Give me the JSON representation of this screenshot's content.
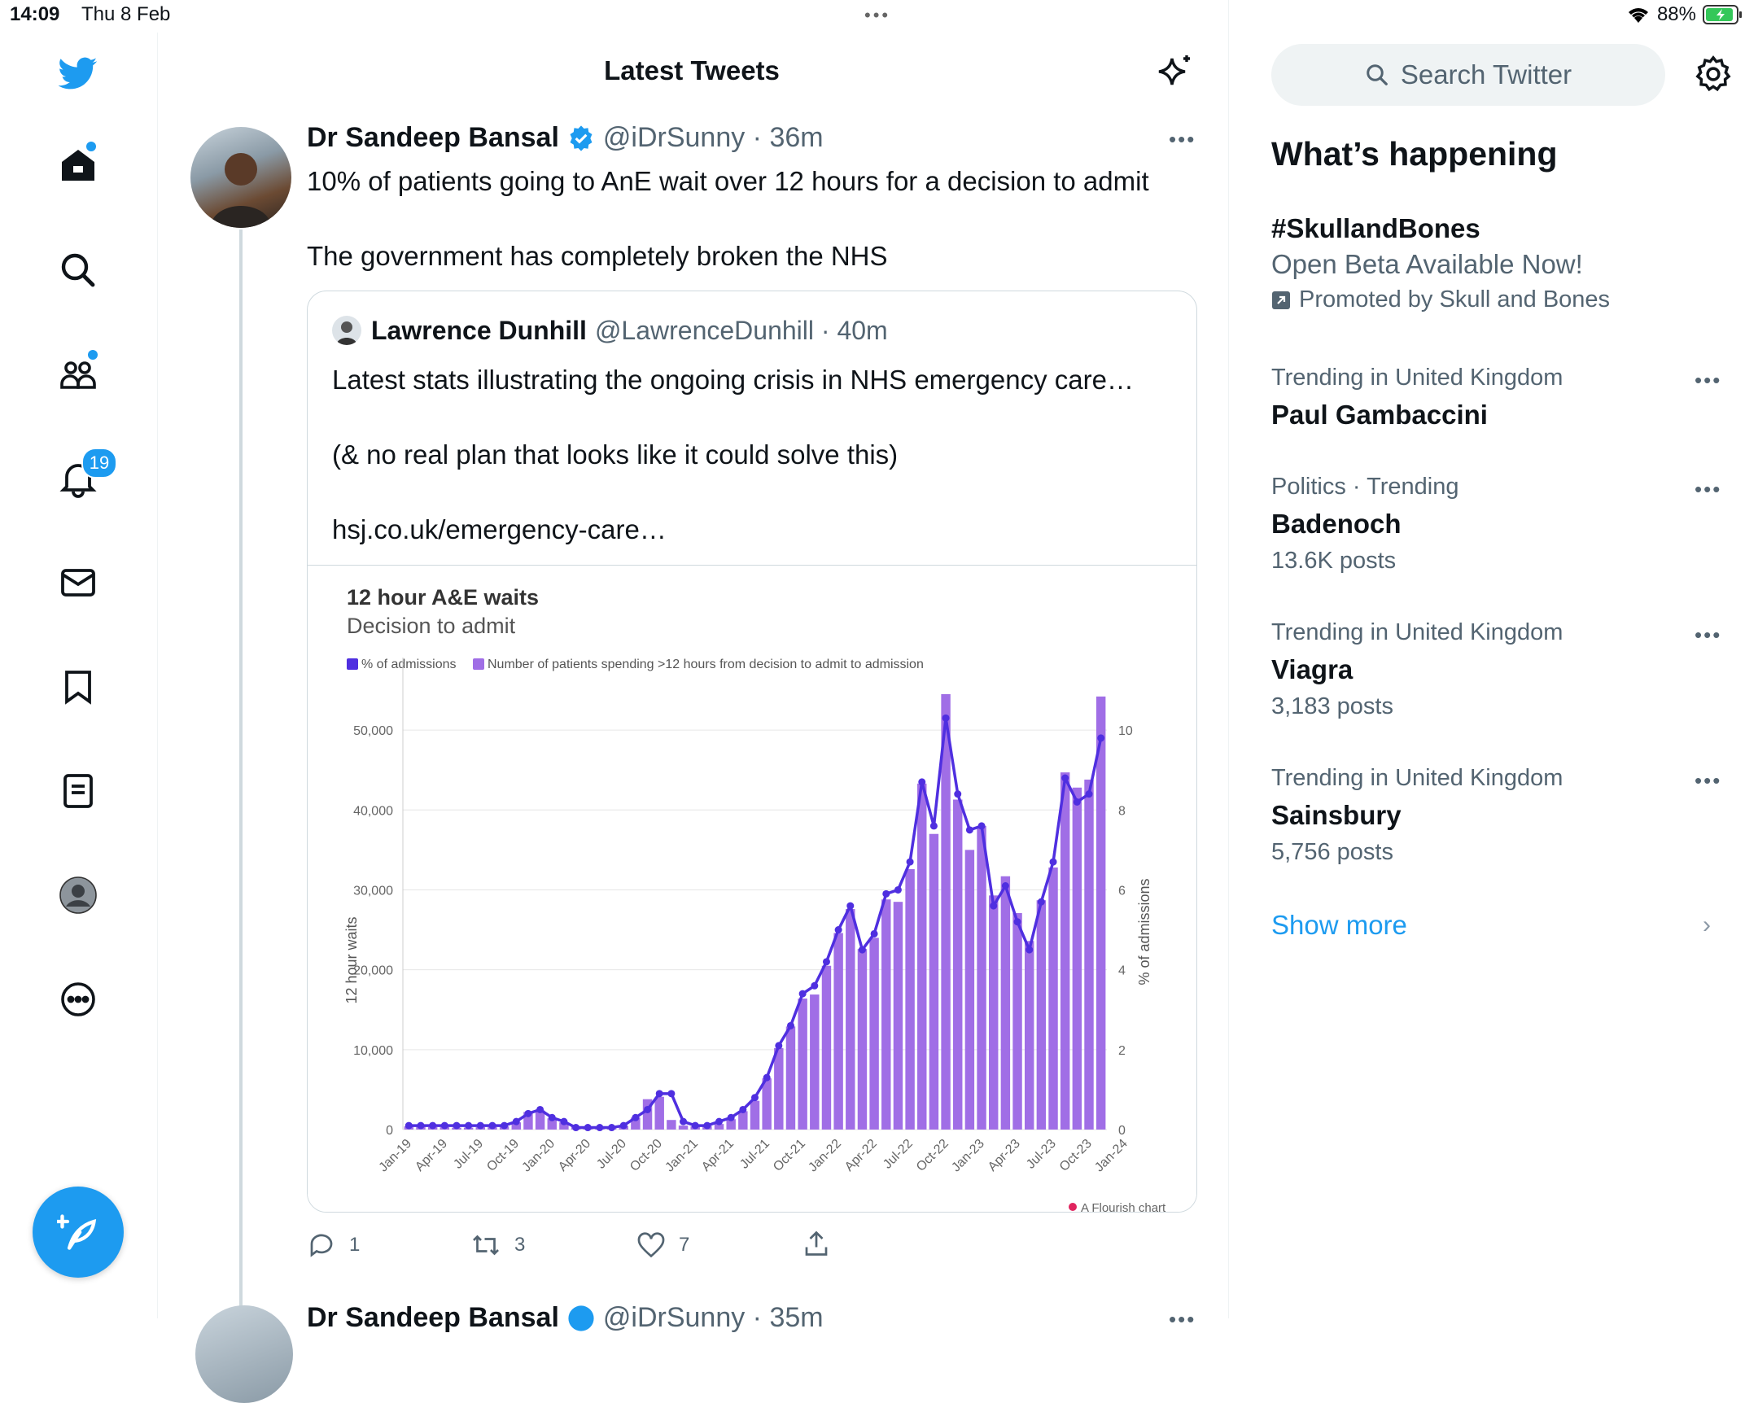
{
  "status": {
    "time": "14:09",
    "date": "Thu 8 Feb",
    "battery": "88%"
  },
  "nav": {
    "notifications_badge": "19"
  },
  "feed": {
    "title": "Latest Tweets"
  },
  "tweet": {
    "name": "Dr Sandeep Bansal",
    "handle": "@iDrSunny · 36m",
    "line1": "10% of patients going to AnE wait over 12 hours for a decision to admit",
    "line2": "The government has completely broken the NHS",
    "replies": "1",
    "retweets": "3",
    "likes": "7"
  },
  "quote": {
    "name": "Lawrence Dunhill",
    "handle": "@LawrenceDunhill · 40m",
    "line1": "Latest stats illustrating the ongoing crisis in NHS emergency care…",
    "line2": "(& no real plan that looks like it could solve this)",
    "line3": "hsj.co.uk/emergency-care…"
  },
  "next_tweet": {
    "name": "Dr Sandeep Bansal",
    "handle": "@iDrSunny · 35m"
  },
  "chart_data": {
    "type": "bar",
    "title": "12 hour A&E waits",
    "subtitle": "Decision to admit",
    "ylabel": "12 hour waits",
    "y2label": "% of admissions",
    "credit": "A Flourish chart",
    "ylim": [
      0,
      55000
    ],
    "y2lim": [
      0,
      11
    ],
    "yticks": [
      "0",
      "10,000",
      "20,000",
      "30,000",
      "40,000",
      "50,000"
    ],
    "y2ticks": [
      "0",
      "2",
      "4",
      "6",
      "8",
      "10"
    ],
    "xtick_labels": [
      "Jan-19",
      "Apr-19",
      "Jul-19",
      "Oct-19",
      "Jan-20",
      "Apr-20",
      "Jul-20",
      "Oct-20",
      "Jan-21",
      "Apr-21",
      "Jul-21",
      "Oct-21",
      "Jan-22",
      "Apr-22",
      "Jul-22",
      "Oct-22",
      "Jan-23",
      "Apr-23",
      "Jul-23",
      "Oct-23",
      "Jan-24"
    ],
    "series": [
      {
        "name": "% of admissions",
        "color": "#4f2fe0",
        "type": "line",
        "values": [
          0.1,
          0.1,
          0.1,
          0.1,
          0.1,
          0.1,
          0.1,
          0.1,
          0.1,
          0.2,
          0.4,
          0.5,
          0.3,
          0.2,
          0.05,
          0.05,
          0.05,
          0.05,
          0.1,
          0.3,
          0.5,
          0.9,
          0.9,
          0.2,
          0.1,
          0.1,
          0.2,
          0.3,
          0.5,
          0.8,
          1.3,
          2.1,
          2.6,
          3.4,
          3.6,
          4.2,
          5.0,
          5.6,
          4.5,
          4.9,
          5.9,
          6.0,
          6.7,
          8.7,
          7.6,
          10.3,
          8.4,
          7.5,
          7.6,
          5.6,
          6.1,
          5.2,
          4.5,
          5.7,
          6.7,
          8.8,
          8.2,
          8.4,
          9.8
        ]
      },
      {
        "name": "Number of patients spending >12 hours from decision to admit to admission",
        "color": "#a06ee6",
        "type": "bar",
        "values": [
          400,
          350,
          300,
          300,
          250,
          250,
          300,
          300,
          400,
          900,
          2200,
          2400,
          1400,
          900,
          400,
          350,
          300,
          250,
          450,
          1500,
          3800,
          4100,
          1200,
          500,
          400,
          450,
          700,
          1300,
          2300,
          3600,
          6400,
          10200,
          12900,
          16400,
          16900,
          20500,
          24600,
          27600,
          22600,
          24000,
          28800,
          28500,
          32600,
          43300,
          37000,
          54500,
          41300,
          35000,
          38000,
          29300,
          31700,
          27100,
          23600,
          28700,
          32800,
          44700,
          42800,
          43800,
          54200
        ]
      }
    ]
  },
  "sidebar": {
    "search_placeholder": "Search Twitter",
    "title": "What’s happening",
    "promo": {
      "tag": "#SkullandBones",
      "text": "Open Beta Available Now!",
      "by": "Promoted by Skull and Bones"
    },
    "trends": [
      {
        "meta": "Trending in United Kingdom",
        "name": "Paul Gambaccini",
        "count": ""
      },
      {
        "meta": "Politics · Trending",
        "name": "Badenoch",
        "count": "13.6K posts"
      },
      {
        "meta": "Trending in United Kingdom",
        "name": "Viagra",
        "count": "3,183 posts"
      },
      {
        "meta": "Trending in United Kingdom",
        "name": "Sainsbury",
        "count": "5,756 posts"
      }
    ],
    "show_more": "Show more"
  }
}
